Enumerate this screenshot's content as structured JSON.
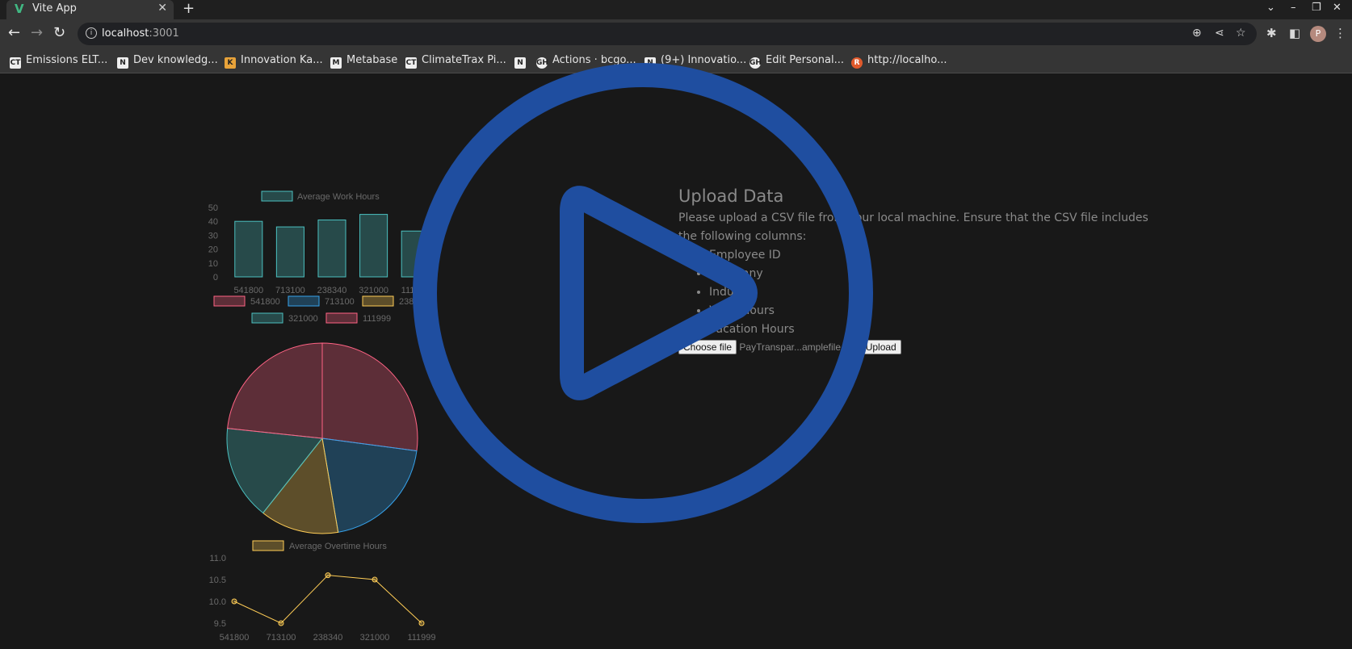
{
  "browser": {
    "tab_title": "Vite App",
    "tab_close": "✕",
    "new_tab": "+",
    "url_host": "localhost",
    "url_port": ":3001",
    "avatar_letter": "P",
    "bookmarks": [
      {
        "label": "Emissions ELT...",
        "icon": "CT"
      },
      {
        "label": "Dev knowledg...",
        "icon": "N"
      },
      {
        "label": "Innovation Ka...",
        "icon": "K"
      },
      {
        "label": "Metabase",
        "icon": "M"
      },
      {
        "label": "ClimateTrax Pi...",
        "icon": "CT"
      },
      {
        "label": "",
        "icon": "N"
      },
      {
        "label": "Actions · bcgo...",
        "icon": "GH"
      },
      {
        "label": "(9+) Innovatio...",
        "icon": "N"
      },
      {
        "label": "Edit Personal...",
        "icon": "GH"
      },
      {
        "label": "http://localho...",
        "icon": "R"
      }
    ]
  },
  "upload": {
    "title": "Upload Data",
    "description": "Please upload a CSV file from your local machine. Ensure that the CSV file includes the following columns:",
    "columns": [
      "Employee ID",
      "Company",
      "Industry",
      "Work Hours",
      "Vacation Hours"
    ],
    "choose_file_label": "Choose file",
    "file_name": "PayTranspar...amplefile.csv",
    "upload_label": "Upload"
  },
  "chart_data": [
    {
      "type": "bar",
      "legend": [
        "Average Work Hours"
      ],
      "categories": [
        "541800",
        "713100",
        "238340",
        "321000",
        "111999"
      ],
      "series": [
        {
          "name": "Average Work Hours",
          "values": [
            40,
            36,
            41,
            45,
            33
          ]
        }
      ],
      "ylim": [
        0,
        50
      ],
      "yticks": [
        0,
        10,
        20,
        30,
        40,
        50
      ],
      "color": "#4bc0c0"
    },
    {
      "type": "pie",
      "legend": [
        "541800",
        "713100",
        "238340",
        "321000",
        "111999"
      ],
      "values": [
        12.2,
        9.1,
        6.0,
        7.2,
        10.5
      ],
      "colors": [
        "#ff6384",
        "#36a2eb",
        "#ffcd56",
        "#4bc0c0",
        "#ff6384"
      ]
    },
    {
      "type": "line",
      "legend": [
        "Average Overtime Hours"
      ],
      "categories": [
        "541800",
        "713100",
        "238340",
        "321000",
        "111999"
      ],
      "series": [
        {
          "name": "Average Overtime Hours",
          "values": [
            10.0,
            9.5,
            10.6,
            10.5,
            9.5
          ]
        }
      ],
      "ylim": [
        9.5,
        11.0
      ],
      "yticks": [
        "9.5",
        "10.0",
        "10.5",
        "11.0"
      ],
      "color": "#ffcd56"
    }
  ]
}
